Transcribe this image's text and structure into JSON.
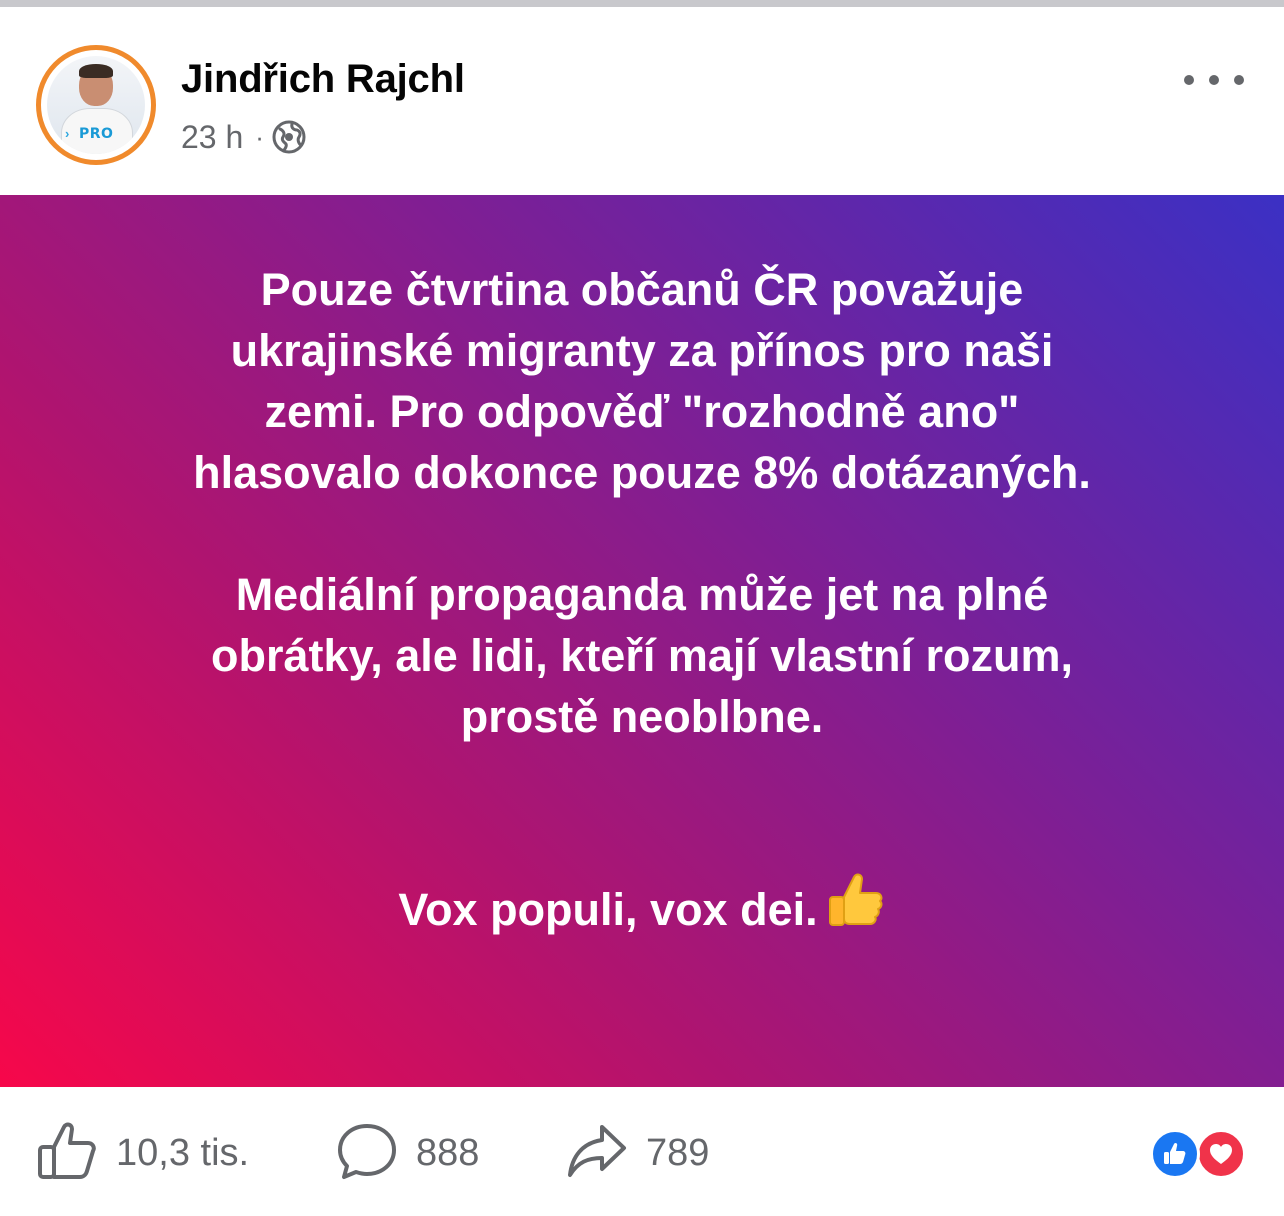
{
  "post": {
    "author": "Jindřich Rajchl",
    "time": "23 h",
    "separator": "·",
    "avatar_badge": "PRO",
    "privacy_icon": "globe-icon",
    "menu_icon": "more-horizontal-icon",
    "body": {
      "paragraph_1": "Pouze čtvrtina občanů ČR považuje\nukrajinské migranty za přínos pro naši\nzemi. Pro odpověď \"rozhodně ano\"\nhlasovalo dokonce pouze 8% dotázaných.",
      "paragraph_2": "Mediální propaganda může jet na plné\nobrátky, ale lidi, kteří mají vlastní rozum,\nprostě neoblbne.",
      "paragraph_3": "Vox populi, vox dei.",
      "emoji_icon": "thumbs-up-emoji-icon"
    },
    "background": {
      "gradient_start": "#f7074a",
      "gradient_mid": "#7d1f95",
      "gradient_end": "#3b30c4"
    }
  },
  "footer": {
    "like": {
      "icon": "like-icon",
      "count": "10,3 tis."
    },
    "comment": {
      "icon": "comment-icon",
      "count": "888"
    },
    "share": {
      "icon": "share-icon",
      "count": "789"
    },
    "reactions": [
      {
        "icon": "like-reaction-icon",
        "color": "#1a77f2"
      },
      {
        "icon": "love-reaction-icon",
        "color": "#f0334a"
      }
    ]
  }
}
